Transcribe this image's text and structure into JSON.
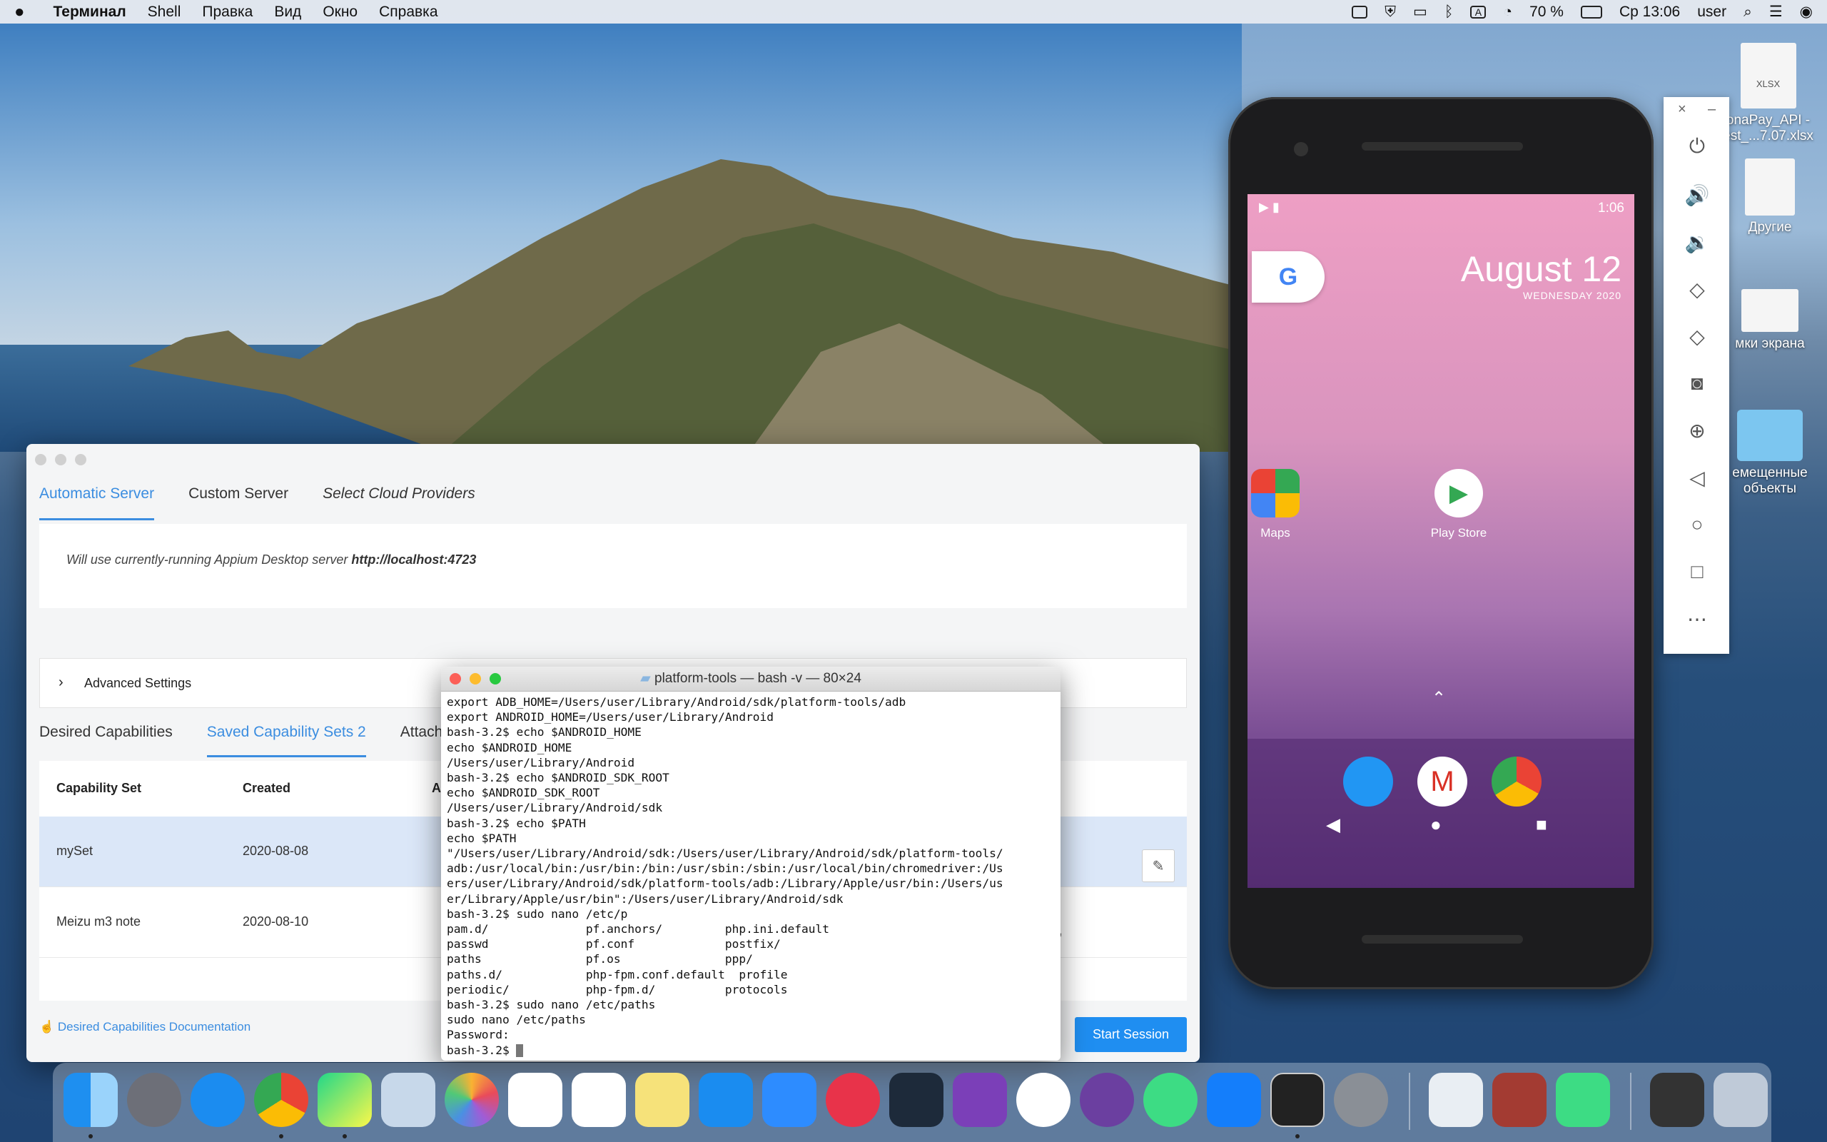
{
  "menubar": {
    "app_name": "Терминал",
    "items": [
      "Shell",
      "Правка",
      "Вид",
      "Окно",
      "Справка"
    ],
    "battery": "70 %",
    "datetime": "Ср 13:06",
    "user": "user"
  },
  "appium": {
    "server_tabs": [
      "Automatic Server",
      "Custom Server",
      "Select Cloud Providers"
    ],
    "server_text_prefix": "Will use currently-running Appium Desktop server",
    "server_url": "http://localhost:4723",
    "advanced_settings": "Advanced Settings",
    "cap_tabs": [
      "Desired Capabilities",
      "Saved Capability Sets 2",
      "Attach"
    ],
    "table_headers": [
      "Capability Set",
      "Created",
      "A"
    ],
    "rows": [
      {
        "name": "mySet",
        "created": "2020-08-08"
      },
      {
        "name": "Meizu m3 note",
        "created": "2020-08-10"
      }
    ],
    "docs_link": "Desired Capabilities Documentation",
    "start_button": "Start Session",
    "stray_text": "\","
  },
  "terminal": {
    "title": "platform-tools — bash -v — 80×24",
    "output": "export ADB_HOME=/Users/user/Library/Android/sdk/platform-tools/adb\nexport ANDROID_HOME=/Users/user/Library/Android\nbash-3.2$ echo $ANDROID_HOME\necho $ANDROID_HOME\n/Users/user/Library/Android\nbash-3.2$ echo $ANDROID_SDK_ROOT\necho $ANDROID_SDK_ROOT\n/Users/user/Library/Android/sdk\nbash-3.2$ echo $PATH\necho $PATH\n\"/Users/user/Library/Android/sdk:/Users/user/Library/Android/sdk/platform-tools/\nadb:/usr/local/bin:/usr/bin:/bin:/usr/sbin:/sbin:/usr/local/bin/chromedriver:/Us\ners/user/Library/Android/sdk/platform-tools/adb:/Library/Apple/usr/bin:/Users/us\ner/Library/Apple/usr/bin\":/Users/user/Library/Android/sdk\nbash-3.2$ sudo nano /etc/p\npam.d/              pf.anchors/         php.ini.default\npasswd              pf.conf             postfix/\npaths               pf.os               ppp/\npaths.d/            php-fpm.conf.default  profile\nperiodic/           php-fpm.d/          protocols\nbash-3.2$ sudo nano /etc/paths\nsudo nano /etc/paths\nPassword:",
    "prompt": "bash-3.2$ "
  },
  "phone": {
    "time": "1:06",
    "date": "August 12",
    "weekday": "WEDNESDAY 2020",
    "google": "G",
    "apps": [
      {
        "label": "Maps"
      },
      {
        "label": "Play Store"
      }
    ]
  },
  "desktop_files": [
    {
      "label": "onaPay_API -\nest_...7.07.xlsx",
      "badge": "XLSX"
    },
    {
      "label": "Другие"
    },
    {
      "label": "мки экрана"
    },
    {
      "label": "емещенные\nобъекты"
    }
  ]
}
